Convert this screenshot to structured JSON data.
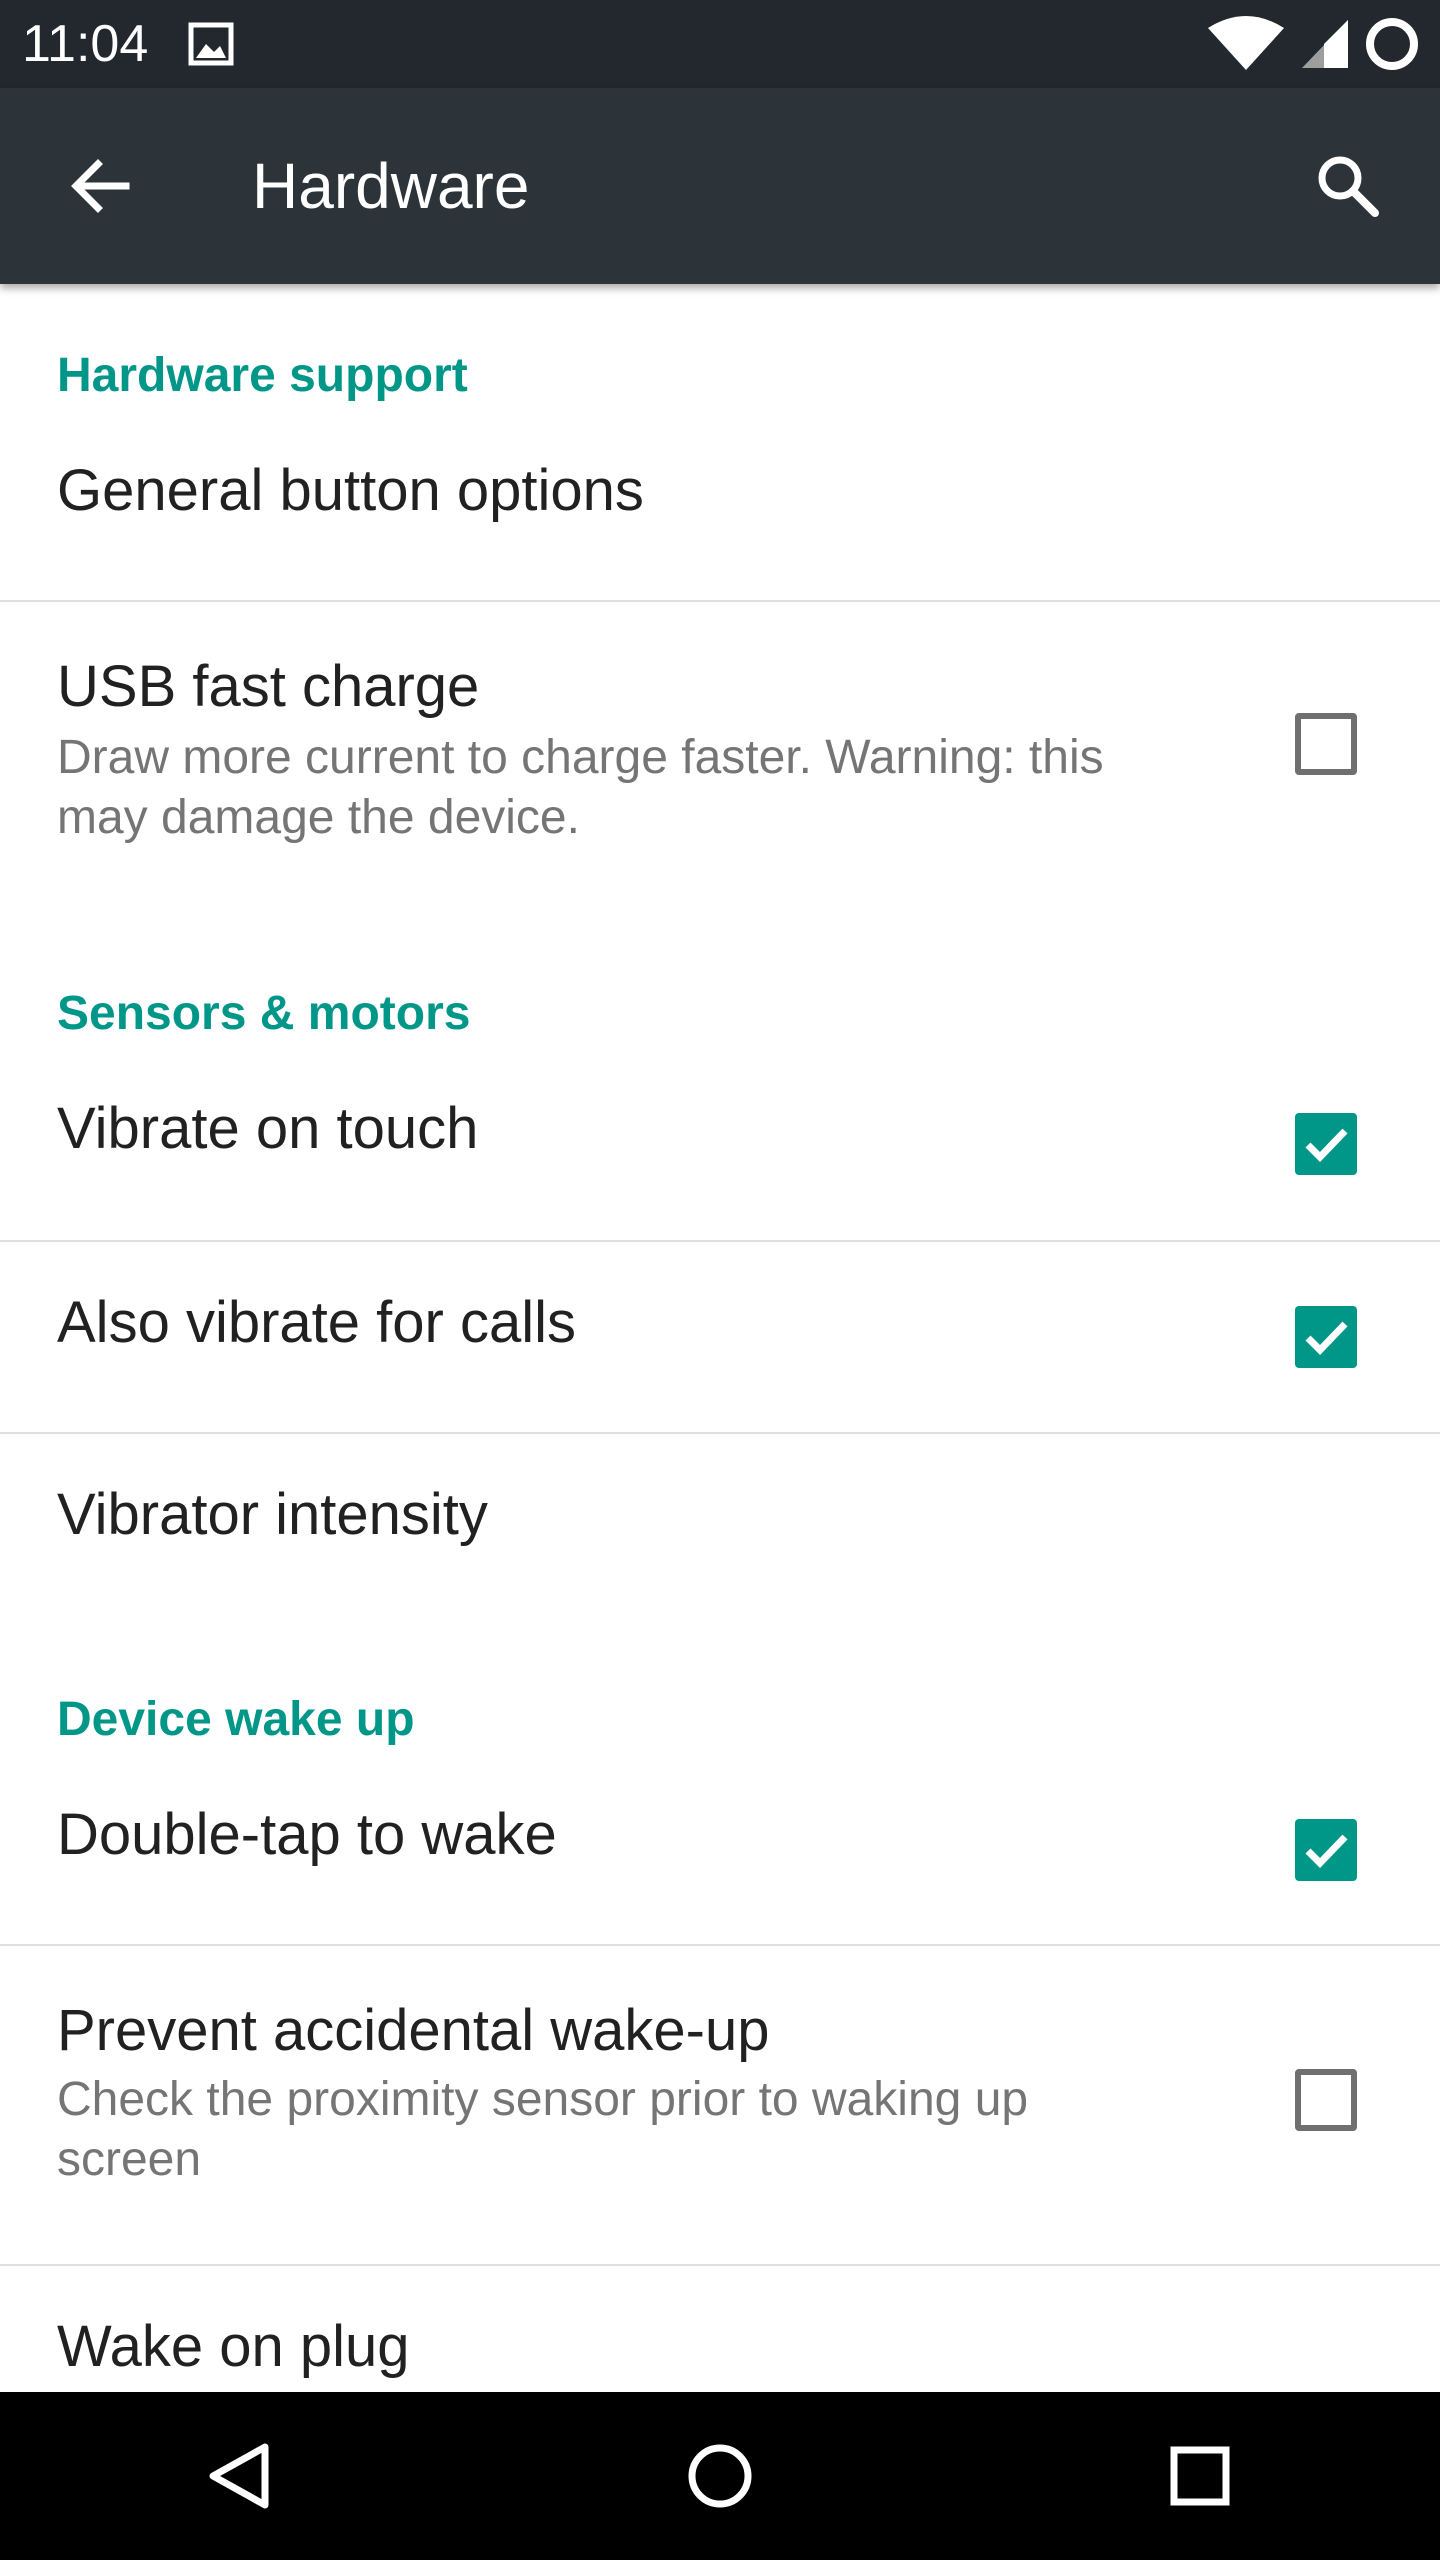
{
  "status_bar": {
    "time": "11:04",
    "icons": [
      "image-icon",
      "wifi-icon",
      "cell-signal-icon",
      "battery-ring-icon"
    ]
  },
  "app_bar": {
    "title": "Hardware",
    "back_icon": "arrow-left-icon",
    "search_icon": "search-icon",
    "background": "#2c343a"
  },
  "accent_color": "#009688",
  "sections": {
    "hardware_support": {
      "header": "Hardware support",
      "general_button_options": {
        "title": "General button options"
      },
      "usb_fast_charge": {
        "title": "USB fast charge",
        "summary_line1": "Draw more current to charge faster. Warning: this",
        "summary_line2": "may damage the device.",
        "checked": false
      }
    },
    "sensors_motors": {
      "header": "Sensors & motors",
      "vibrate_on_touch": {
        "title": "Vibrate on touch",
        "checked": true
      },
      "also_vibrate_calls": {
        "title": "Also vibrate for calls",
        "checked": true
      },
      "vibrator_intensity": {
        "title": "Vibrator intensity"
      }
    },
    "device_wake_up": {
      "header": "Device wake up",
      "double_tap_wake": {
        "title": "Double-tap to wake",
        "checked": true
      },
      "prevent_accidental_wake": {
        "title": "Prevent accidental wake-up",
        "summary_line1": "Check the proximity sensor prior to waking up",
        "summary_line2": "screen",
        "checked": false
      },
      "wake_on_plug": {
        "title": "Wake on plug"
      }
    }
  },
  "nav_bar": {
    "back_icon": "nav-back-triangle-icon",
    "home_icon": "nav-home-circle-icon",
    "recents_icon": "nav-recents-square-icon"
  }
}
